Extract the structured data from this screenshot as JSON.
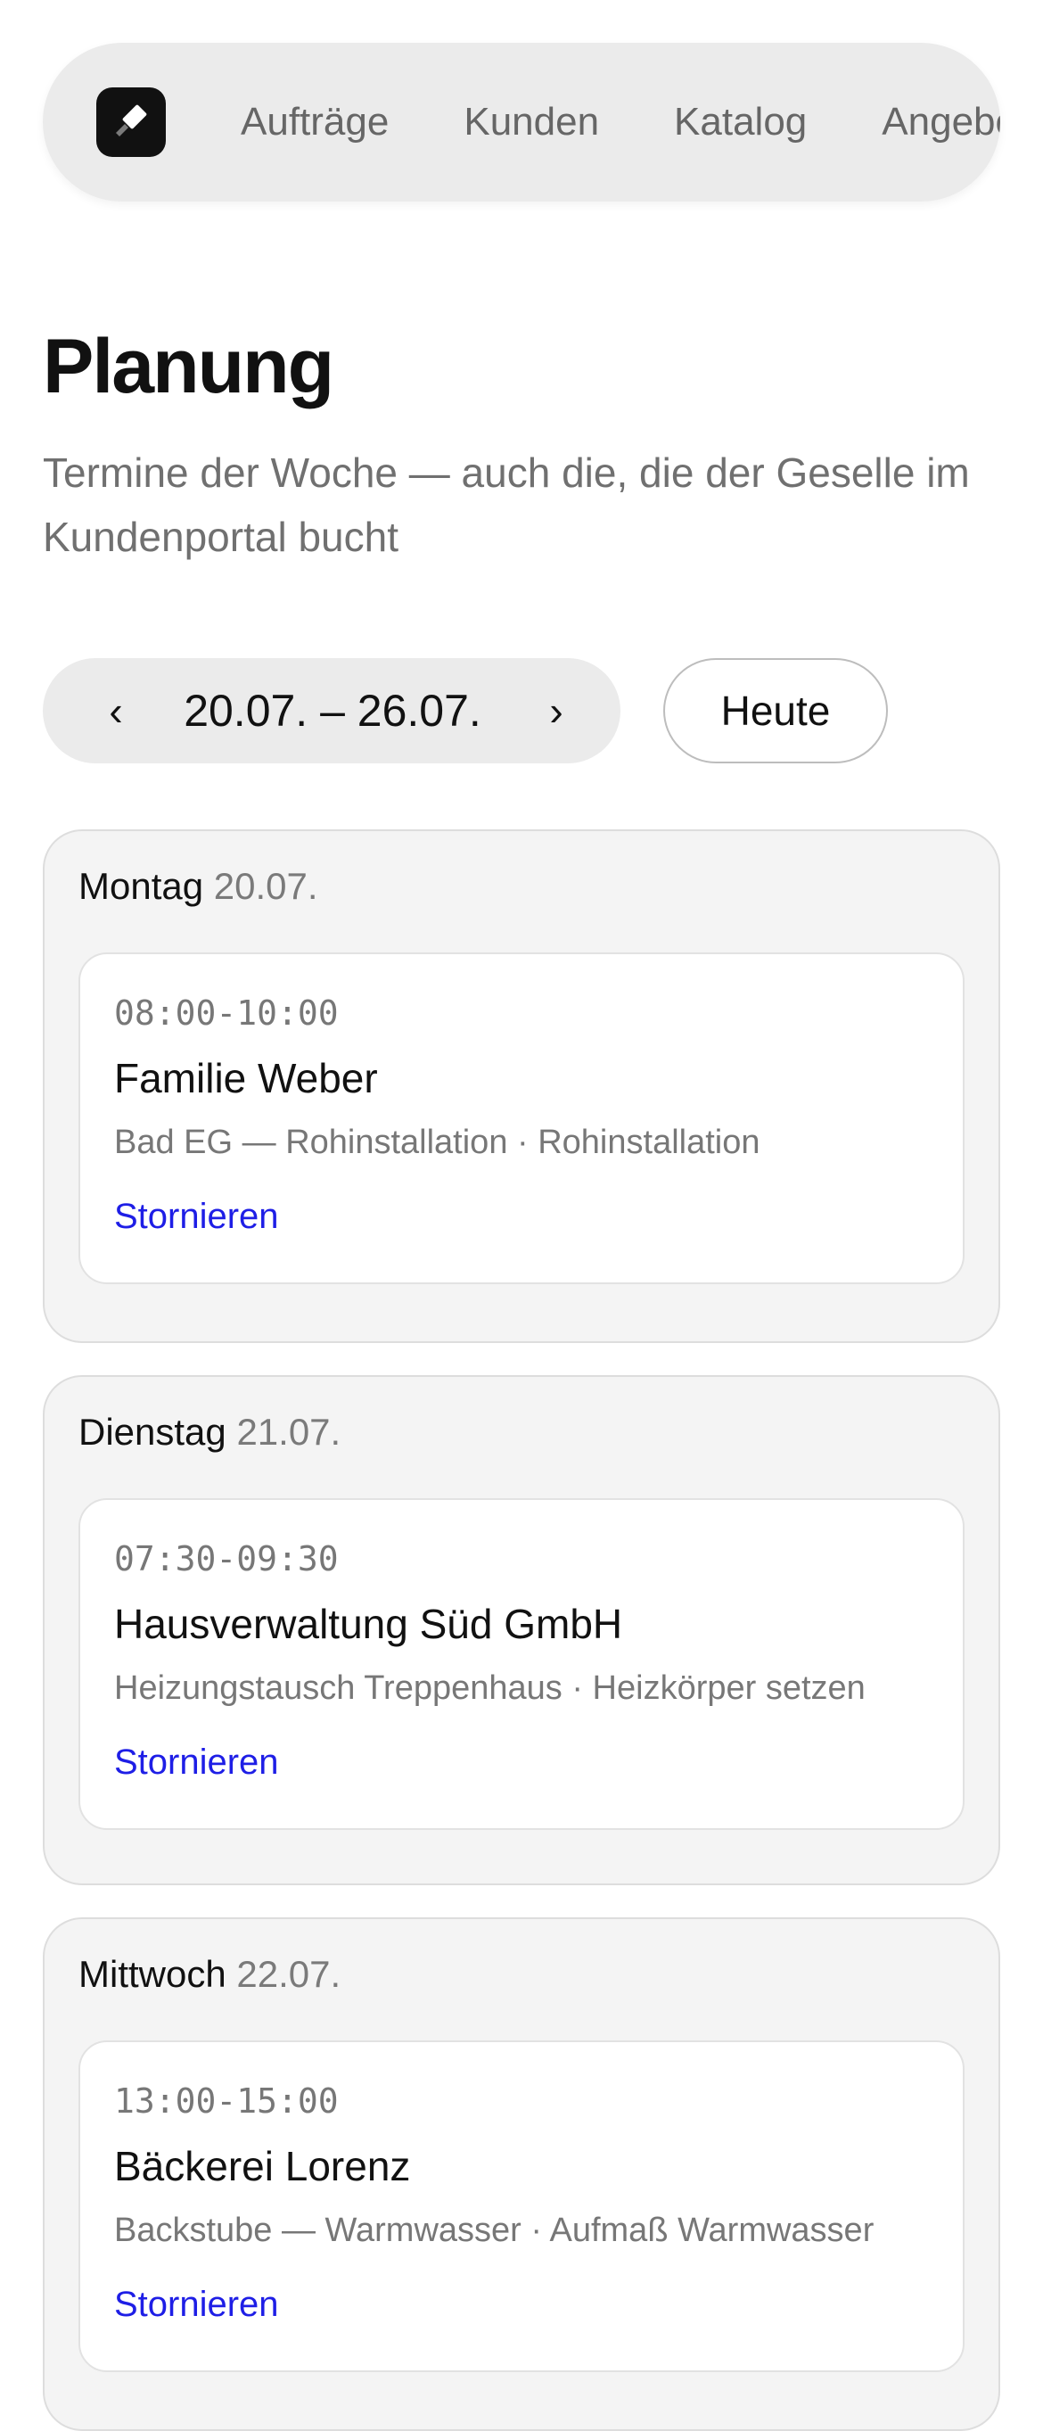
{
  "nav": {
    "items": [
      "Aufträge",
      "Kunden",
      "Katalog",
      "Angebote"
    ]
  },
  "page": {
    "title": "Planung",
    "subtitle": "Termine der Woche — auch die, die der Geselle im Kundenportal bucht"
  },
  "week": {
    "prev": "‹",
    "range": "20.07. – 26.07.",
    "next": "›",
    "today": "Heute"
  },
  "days": [
    {
      "weekday": "Montag",
      "date": "20.07.",
      "appointment": {
        "time": "08:00-10:00",
        "client": "Familie Weber",
        "detail": "Bad EG — Rohinstallation · Rohinstallation",
        "action": "Stornieren"
      }
    },
    {
      "weekday": "Dienstag",
      "date": "21.07.",
      "appointment": {
        "time": "07:30-09:30",
        "client": "Hausverwaltung Süd GmbH",
        "detail": "Heizungstausch Treppenhaus · Heizkörper setzen",
        "action": "Stornieren"
      }
    },
    {
      "weekday": "Mittwoch",
      "date": "22.07.",
      "appointment": {
        "time": "13:00-15:00",
        "client": "Bäckerei Lorenz",
        "detail": "Backstube — Warmwasser · Aufmaß Warmwasser",
        "action": "Stornieren"
      }
    }
  ],
  "colors": {
    "link": "#1e1ee6",
    "nav_bg": "#ebebeb",
    "day_bg": "#f4f4f4"
  }
}
